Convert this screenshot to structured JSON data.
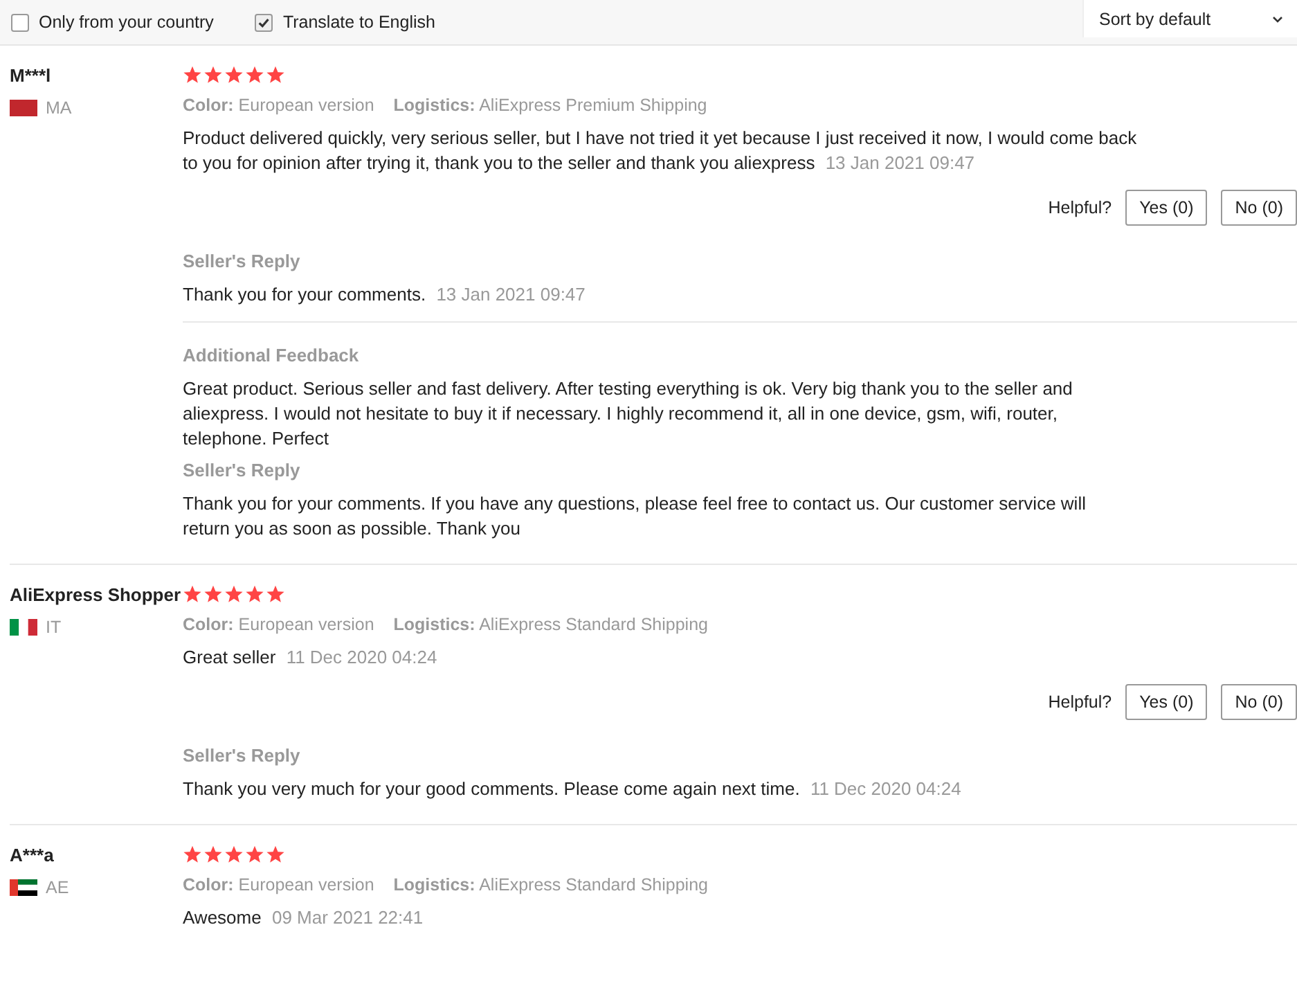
{
  "filters": [
    {
      "label": "Only from your country",
      "checked": false
    },
    {
      "label": "Translate to English",
      "checked": true
    }
  ],
  "sort": {
    "value": "Sort by default"
  },
  "reviews": [
    {
      "author": "M***l",
      "flag": {
        "kind": "morocco"
      },
      "country": "MA",
      "stars": 5,
      "color_label": "Color:",
      "color_value": "European version",
      "logistics_label": "Logistics:",
      "logistics_value": "AliExpress Premium Shipping",
      "text": "Product delivered quickly, very serious seller, but I have not tried it yet because I just received it now, I would come back to you for opinion after trying it, thank you to the seller and thank you aliexpress",
      "date": "13 Jan 2021 09:47",
      "helpful": {
        "label": "Helpful?",
        "yes": "Yes (0)",
        "no": "No (0)"
      },
      "followups": [
        {
          "kind": "reply",
          "title": "Seller's Reply",
          "text": "Thank you for your comments.",
          "date": "13 Jan 2021 09:47"
        },
        {
          "kind": "feedback",
          "title": "Additional Feedback",
          "text": "Great product. Serious seller and fast delivery. After testing everything is ok. Very big thank you to the seller and aliexpress. I would not hesitate to buy it if necessary. I highly recommend it, all in one device, gsm, wifi, router, telephone. Perfect"
        },
        {
          "kind": "reply",
          "title": "Seller's Reply",
          "text": "Thank you for your comments. If you have any questions, please feel free to contact us. Our customer service will return you as soon as possible. Thank you"
        }
      ]
    },
    {
      "author": "AliExpress Shopper",
      "flag": {
        "kind": "italy"
      },
      "country": "IT",
      "stars": 5,
      "color_label": "Color:",
      "color_value": "European version",
      "logistics_label": "Logistics:",
      "logistics_value": "AliExpress Standard Shipping",
      "text": "Great seller",
      "date": "11 Dec 2020 04:24",
      "helpful": {
        "label": "Helpful?",
        "yes": "Yes (0)",
        "no": "No (0)"
      },
      "followups": [
        {
          "kind": "reply",
          "title": "Seller's Reply",
          "text": "Thank you very much for your good comments. Please come again next time.",
          "date": "11 Dec 2020 04:24"
        }
      ]
    },
    {
      "author": "A***a",
      "flag": {
        "kind": "uae"
      },
      "country": "AE",
      "stars": 5,
      "color_label": "Color:",
      "color_value": "European version",
      "logistics_label": "Logistics:",
      "logistics_value": "AliExpress Standard Shipping",
      "text": "Awesome",
      "date": "09 Mar 2021 22:41"
    }
  ]
}
